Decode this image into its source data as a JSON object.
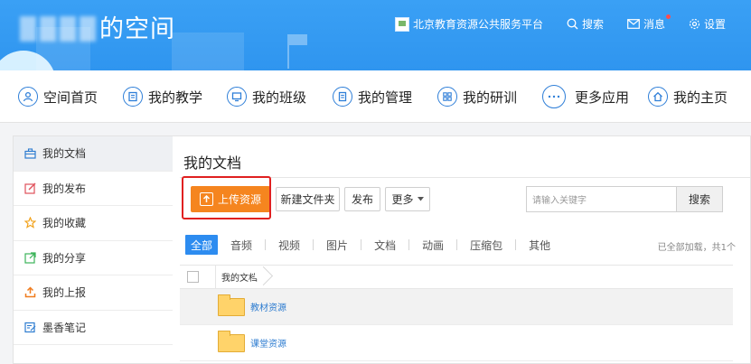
{
  "header": {
    "title": "的空间",
    "platform_link": "北京教育资源公共服务平台",
    "search_label": "搜索",
    "messages_label": "消息",
    "settings_label": "设置"
  },
  "tabs": [
    {
      "label": "空间首页",
      "icon": "user-icon"
    },
    {
      "label": "我的教学",
      "icon": "book-icon"
    },
    {
      "label": "我的班级",
      "icon": "monitor-icon"
    },
    {
      "label": "我的管理",
      "icon": "document-icon"
    },
    {
      "label": "我的研训",
      "icon": "grid-icon"
    },
    {
      "label": "更多应用",
      "icon": "more-icon"
    },
    {
      "label": "我的主页",
      "icon": "home-icon"
    }
  ],
  "sidebar": {
    "items": [
      {
        "label": "我的文档",
        "icon": "briefcase-icon",
        "active": true
      },
      {
        "label": "我的发布",
        "icon": "edit-icon"
      },
      {
        "label": "我的收藏",
        "icon": "star-icon"
      },
      {
        "label": "我的分享",
        "icon": "share-icon"
      },
      {
        "label": "我的上报",
        "icon": "upload-report-icon"
      },
      {
        "label": "墨香笔记",
        "icon": "note-icon"
      }
    ]
  },
  "main": {
    "title": "我的文档",
    "upload_label": "上传资源",
    "new_folder_label": "新建文件夹",
    "publish_label": "发布",
    "more_label": "更多",
    "search_placeholder": "请输入关键字",
    "search_button": "搜索",
    "filters": [
      "全部",
      "音频",
      "视频",
      "图片",
      "文档",
      "动画",
      "压缩包",
      "其他"
    ],
    "loaded_text": "已全部加载，共1个",
    "breadcrumb": "我的文档",
    "files": [
      {
        "name": "教材资源"
      },
      {
        "name": "课堂资源"
      }
    ]
  },
  "colors": {
    "header_blue": "#2f95ef",
    "accent_orange": "#f5851f",
    "filter_active": "#2d8cf0",
    "highlight_red": "#e02020"
  }
}
